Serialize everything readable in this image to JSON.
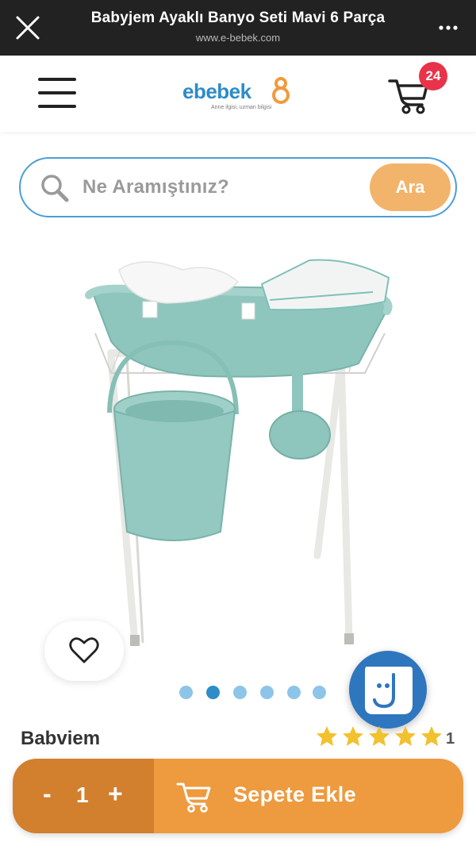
{
  "browser": {
    "title": "Babyjem Ayaklı Banyo Seti Mavi 6 Parça",
    "url": "www.e-bebek.com"
  },
  "header": {
    "logo_text": "ebebek",
    "logo_tagline": "Anne ilgisi, uzman bilgisi",
    "cart_count": "24"
  },
  "search": {
    "placeholder": "Ne Aramıştınız?",
    "button_label": "Ara"
  },
  "gallery": {
    "total_images": 6,
    "active_index": 1
  },
  "product": {
    "brand": "Babviem",
    "rating": 5,
    "rating_count": "1"
  },
  "action_bar": {
    "minus_label": "-",
    "quantity": "1",
    "plus_label": "+",
    "add_to_cart_label": "Sepete Ekle"
  },
  "colors": {
    "brand_blue": "#2E8CC8",
    "badge_red": "#E8334A",
    "search_button": "#F2B46B",
    "add_to_cart": "#EE9A3F",
    "quantity_box": "#D27F2E",
    "star": "#F2C12E"
  },
  "icons": [
    "close-icon",
    "more-icon",
    "menu-icon",
    "stroller-cart-icon",
    "search-icon",
    "heart-icon",
    "chat-icon",
    "star-icon"
  ]
}
